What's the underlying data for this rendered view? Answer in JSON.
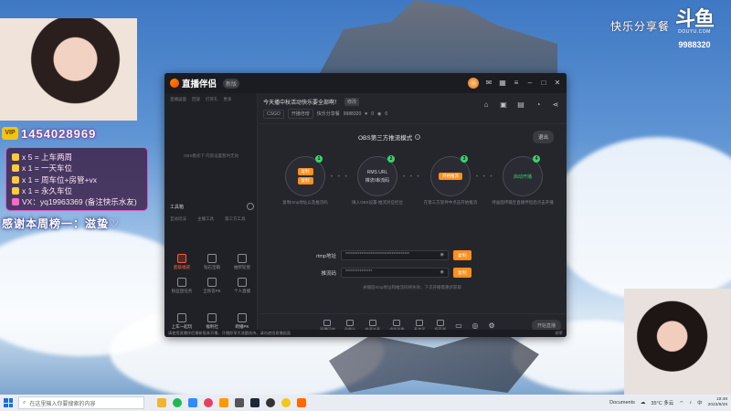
{
  "stream_overlay": {
    "streamer_badge": "VIP",
    "streamer_id": "1454028969",
    "gift_rules": [
      "x 5 = 上车两周",
      "x 1 = 一天车位",
      "x 1 = 周车位+房管+vx",
      "x 1 = 永久车位",
      "VX：yq19963369  (备注快乐水友)"
    ],
    "thanks_text": "感谢本周榜一：滋蛰♡",
    "room_title": "快乐分享餐",
    "platform_logo": "斗鱼",
    "platform_site": "DOUYU.COM",
    "room_number": "9988320"
  },
  "app": {
    "name": "直播伴侣",
    "version": "新版",
    "left_nav": [
      "直播画面",
      "回放",
      "打赏礼",
      "更多"
    ],
    "empty_scene_text": "OBS模式下 内容设置暂时无效",
    "tools_title": "工具箱",
    "tool_tabs": [
      "互动玩法",
      "主播工具",
      "第三方工具"
    ],
    "tools": [
      {
        "label": "超级福袋",
        "hot": true
      },
      {
        "label": "钻石宝箱",
        "hot": false
      },
      {
        "label": "抽奖轮盘",
        "hot": false
      },
      {
        "label": "粉丝团任务",
        "hot": false
      },
      {
        "label": "全民答PK",
        "hot": false
      },
      {
        "label": "个人直播",
        "hot": false
      }
    ],
    "bottom_tools": [
      "上车一起玩",
      "福利社",
      "跨播PK"
    ],
    "room": {
      "title": "今天播中秋活动快乐要全部啊！",
      "edit_label": "修改",
      "category": "CSGO",
      "tag": "开播倍增",
      "share_label": "快乐分享餐",
      "room_id": "9988320",
      "likes": "0",
      "viewers": "0"
    },
    "mode_title": "OBS第三方推流模式",
    "exit_label": "退出",
    "steps": [
      {
        "num": "1",
        "pills": [
          "复制",
          "复制"
        ],
        "desc": "复制rtmp地址以及推流码"
      },
      {
        "num": "2",
        "text1": "RMS URL",
        "text2": "推流/串流码",
        "desc": "填入OBS设置-推流对应栏位"
      },
      {
        "num": "3",
        "pills": [
          "开始推流"
        ],
        "desc": "在第三方软件中点击开始推流"
      },
      {
        "num": "4",
        "text1": "启动开播",
        "desc": "待画面传输至直播伴侣后点击开播"
      }
    ],
    "rtmp_label": "rtmp地址",
    "rtmp_value": "************************************",
    "stream_key_label": "推流码",
    "stream_key_value": "***************",
    "copy_label": "复制",
    "hint": "关播后rtmp地址和推流码将失效，下次开播需重新获取",
    "bottom_bar": [
      {
        "label": "直播回放"
      },
      {
        "label": "录像头"
      },
      {
        "label": "申请连麦"
      },
      {
        "label": "虚拟形象"
      },
      {
        "label": "麦克风"
      },
      {
        "label": "扬声器"
      }
    ],
    "start_live_label": "开始直播",
    "status_text": "请使用直播伴侣最新版本开播，开播即享大流量扶持，请勿遮挡直播画面",
    "status_right": "帧率"
  },
  "taskbar": {
    "search_placeholder": "在这里输入你要搜索的内容",
    "documents_label": "Documents",
    "weather": "35°C 多云",
    "lang": "中",
    "time": "19:48",
    "date": "2023/9/28"
  },
  "colors": {
    "accent": "#ff8f1e",
    "success": "#3bd16f",
    "gift_border": "#d65bd0"
  }
}
